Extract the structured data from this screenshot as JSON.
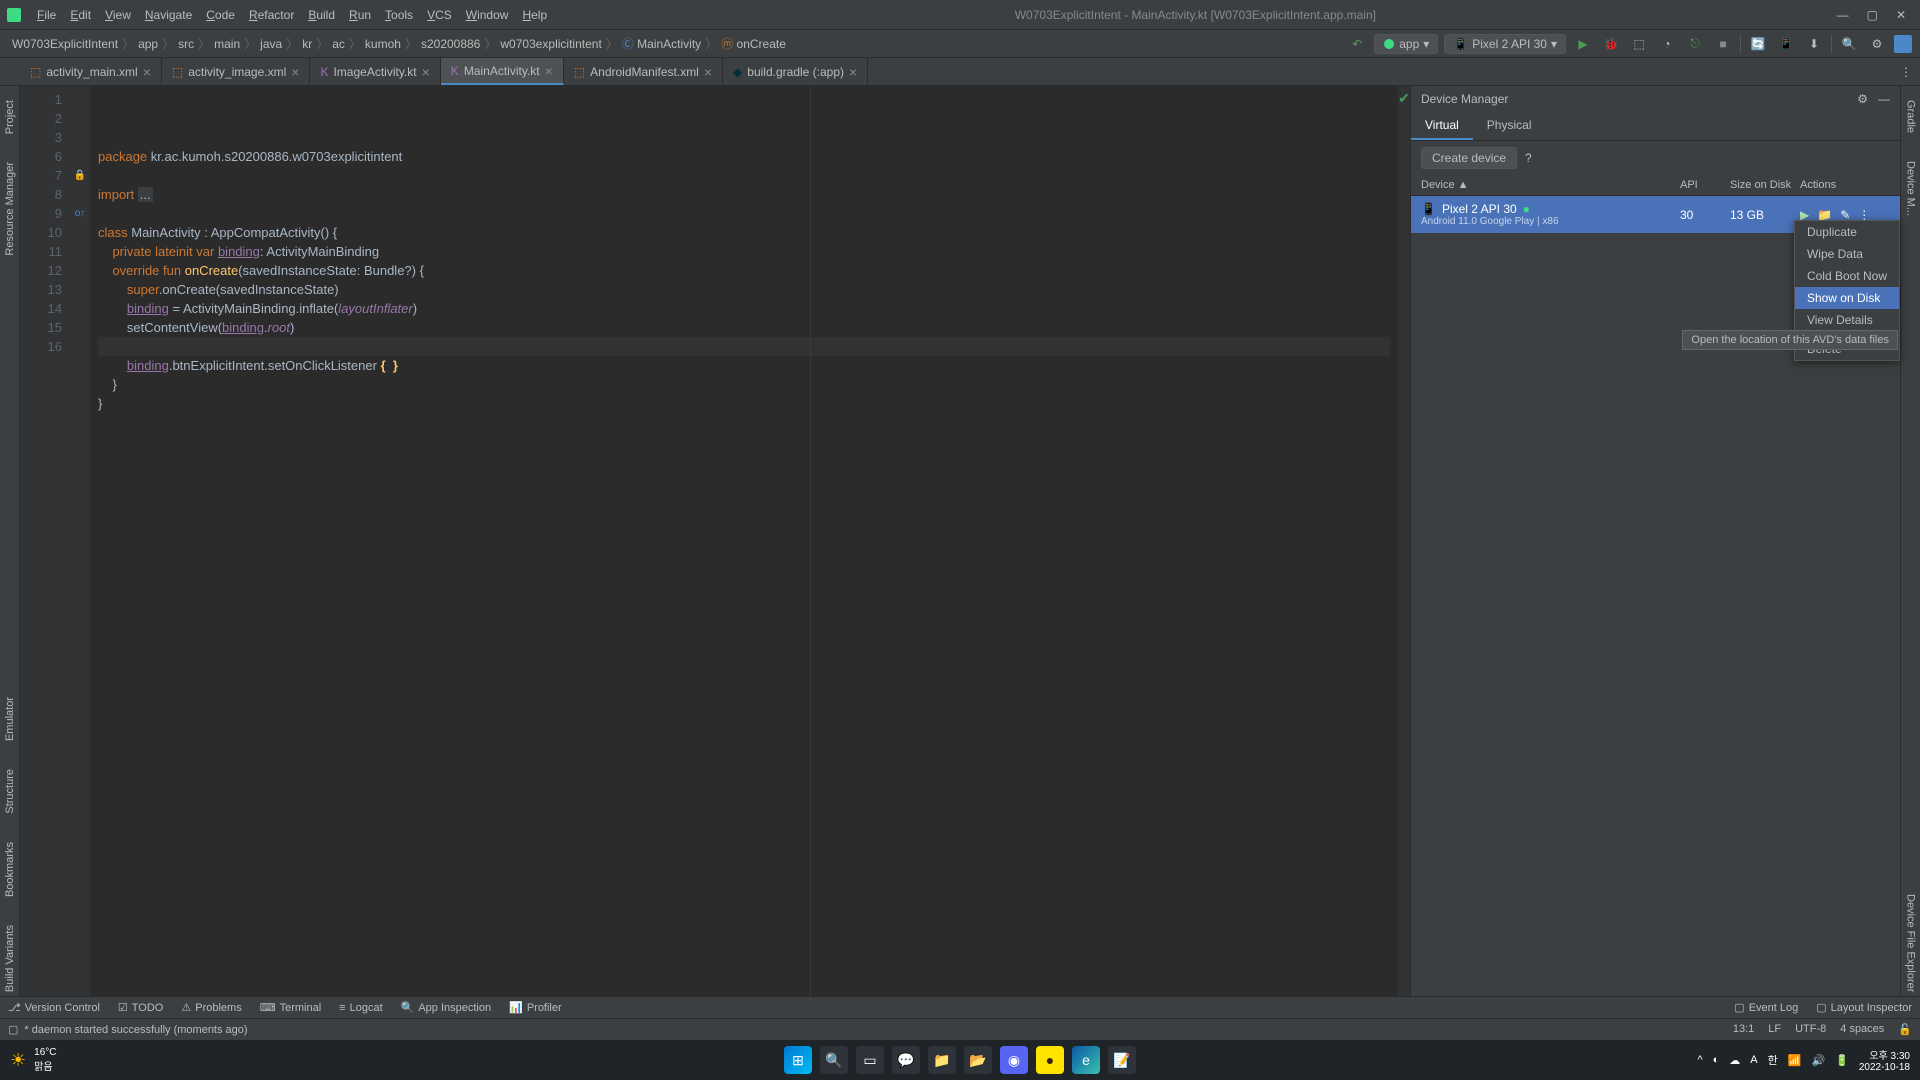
{
  "window": {
    "title": "W0703ExplicitIntent - MainActivity.kt [W0703ExplicitIntent.app.main]"
  },
  "menu": [
    "File",
    "Edit",
    "View",
    "Navigate",
    "Code",
    "Refactor",
    "Build",
    "Run",
    "Tools",
    "VCS",
    "Window",
    "Help"
  ],
  "breadcrumbs": [
    "W0703ExplicitIntent",
    "app",
    "src",
    "main",
    "java",
    "kr",
    "ac",
    "kumoh",
    "s20200886",
    "w0703explicitintent",
    "MainActivity",
    "onCreate"
  ],
  "run_config": {
    "module": "app",
    "device": "Pixel 2 API 30"
  },
  "editor_tabs": [
    {
      "name": "activity_main.xml",
      "icon": "xml",
      "active": false
    },
    {
      "name": "activity_image.xml",
      "icon": "xml",
      "active": false
    },
    {
      "name": "ImageActivity.kt",
      "icon": "kt",
      "active": false
    },
    {
      "name": "MainActivity.kt",
      "icon": "kt",
      "active": true
    },
    {
      "name": "AndroidManifest.xml",
      "icon": "xml",
      "active": false
    },
    {
      "name": "build.gradle (:app)",
      "icon": "gradle",
      "active": false
    }
  ],
  "left_tools": [
    "Project",
    "Resource Manager",
    "Structure",
    "Bookmarks",
    "Build Variants",
    "Emulator"
  ],
  "right_tools": [
    "Gradle",
    "Device Manager",
    "Device File Explorer"
  ],
  "code": {
    "lines": [
      {
        "n": 1,
        "text": [
          {
            "t": "package ",
            "c": "kw"
          },
          {
            "t": "kr.ac.kumoh.s20200886.w0703explicitintent",
            "c": ""
          }
        ]
      },
      {
        "n": 2,
        "text": []
      },
      {
        "n": 3,
        "text": [
          {
            "t": "import ",
            "c": "kw"
          },
          {
            "t": "...",
            "c": "com",
            "bg": true
          }
        ]
      },
      {
        "n": 6,
        "text": []
      },
      {
        "n": 7,
        "mark": "class",
        "text": [
          {
            "t": "class ",
            "c": "kw"
          },
          {
            "t": "MainActivity : AppCompatActivity() {",
            "c": ""
          }
        ]
      },
      {
        "n": 8,
        "text": [
          {
            "t": "    private lateinit var ",
            "c": "kw"
          },
          {
            "t": "binding",
            "c": "under"
          },
          {
            "t": ": ActivityMainBinding",
            "c": ""
          }
        ]
      },
      {
        "n": 9,
        "mark": "over",
        "text": [
          {
            "t": "    override fun ",
            "c": "kw"
          },
          {
            "t": "onCreate",
            "c": "fn"
          },
          {
            "t": "(savedInstanceState: Bundle?) {",
            "c": ""
          }
        ]
      },
      {
        "n": 10,
        "text": [
          {
            "t": "        super",
            "c": "kw"
          },
          {
            "t": ".onCreate(savedInstanceState)",
            "c": ""
          }
        ]
      },
      {
        "n": 11,
        "text": [
          {
            "t": "        ",
            "c": ""
          },
          {
            "t": "binding",
            "c": "under"
          },
          {
            "t": " = ActivityMainBinding.inflate(",
            "c": ""
          },
          {
            "t": "layoutInflater",
            "c": "ital"
          },
          {
            "t": ")",
            "c": ""
          }
        ]
      },
      {
        "n": 12,
        "text": [
          {
            "t": "        setContentView(",
            "c": ""
          },
          {
            "t": "binding",
            "c": "under"
          },
          {
            "t": ".",
            "c": ""
          },
          {
            "t": "root",
            "c": "ital"
          },
          {
            "t": ")",
            "c": ""
          }
        ]
      },
      {
        "n": 13,
        "caret": true,
        "text": []
      },
      {
        "n": 14,
        "text": [
          {
            "t": "        ",
            "c": ""
          },
          {
            "t": "binding",
            "c": "under"
          },
          {
            "t": ".btnExplicitIntent.setOnClickListener ",
            "c": ""
          },
          {
            "t": "{  }",
            "c": "fn",
            "bold": true
          }
        ]
      },
      {
        "n": 15,
        "text": [
          {
            "t": "    }",
            "c": ""
          }
        ]
      },
      {
        "n": 16,
        "text": [
          {
            "t": "}",
            "c": ""
          }
        ]
      }
    ]
  },
  "device_manager": {
    "title": "Device Manager",
    "tabs": [
      "Virtual",
      "Physical"
    ],
    "active_tab": "Virtual",
    "create": "Create device",
    "help": "?",
    "columns": {
      "device": "Device ▲",
      "api": "API",
      "size": "Size on Disk",
      "actions": "Actions"
    },
    "rows": [
      {
        "name": "Pixel 2 API 30",
        "sub": "Android 11.0 Google Play | x86",
        "api": "30",
        "size": "13 GB",
        "running": true
      }
    ],
    "context_menu": [
      "Duplicate",
      "Wipe Data",
      "Cold Boot Now",
      "Show on Disk",
      "View Details",
      "Delete"
    ],
    "context_hover": "Show on Disk",
    "tooltip": "Open the location of this AVD's data files"
  },
  "bottom_tools": [
    "Version Control",
    "TODO",
    "Problems",
    "Terminal",
    "Logcat",
    "App Inspection",
    "Profiler"
  ],
  "bottom_right": [
    "Event Log",
    "Layout Inspector"
  ],
  "status": {
    "msg": "* daemon started successfully (moments ago)",
    "pos": "13:1",
    "lf": "LF",
    "enc": "UTF-8",
    "indent": "4 spaces"
  },
  "taskbar": {
    "temp": "16°C",
    "weather": "맑음",
    "time": "오후 3:30",
    "date": "2022-10-18"
  }
}
